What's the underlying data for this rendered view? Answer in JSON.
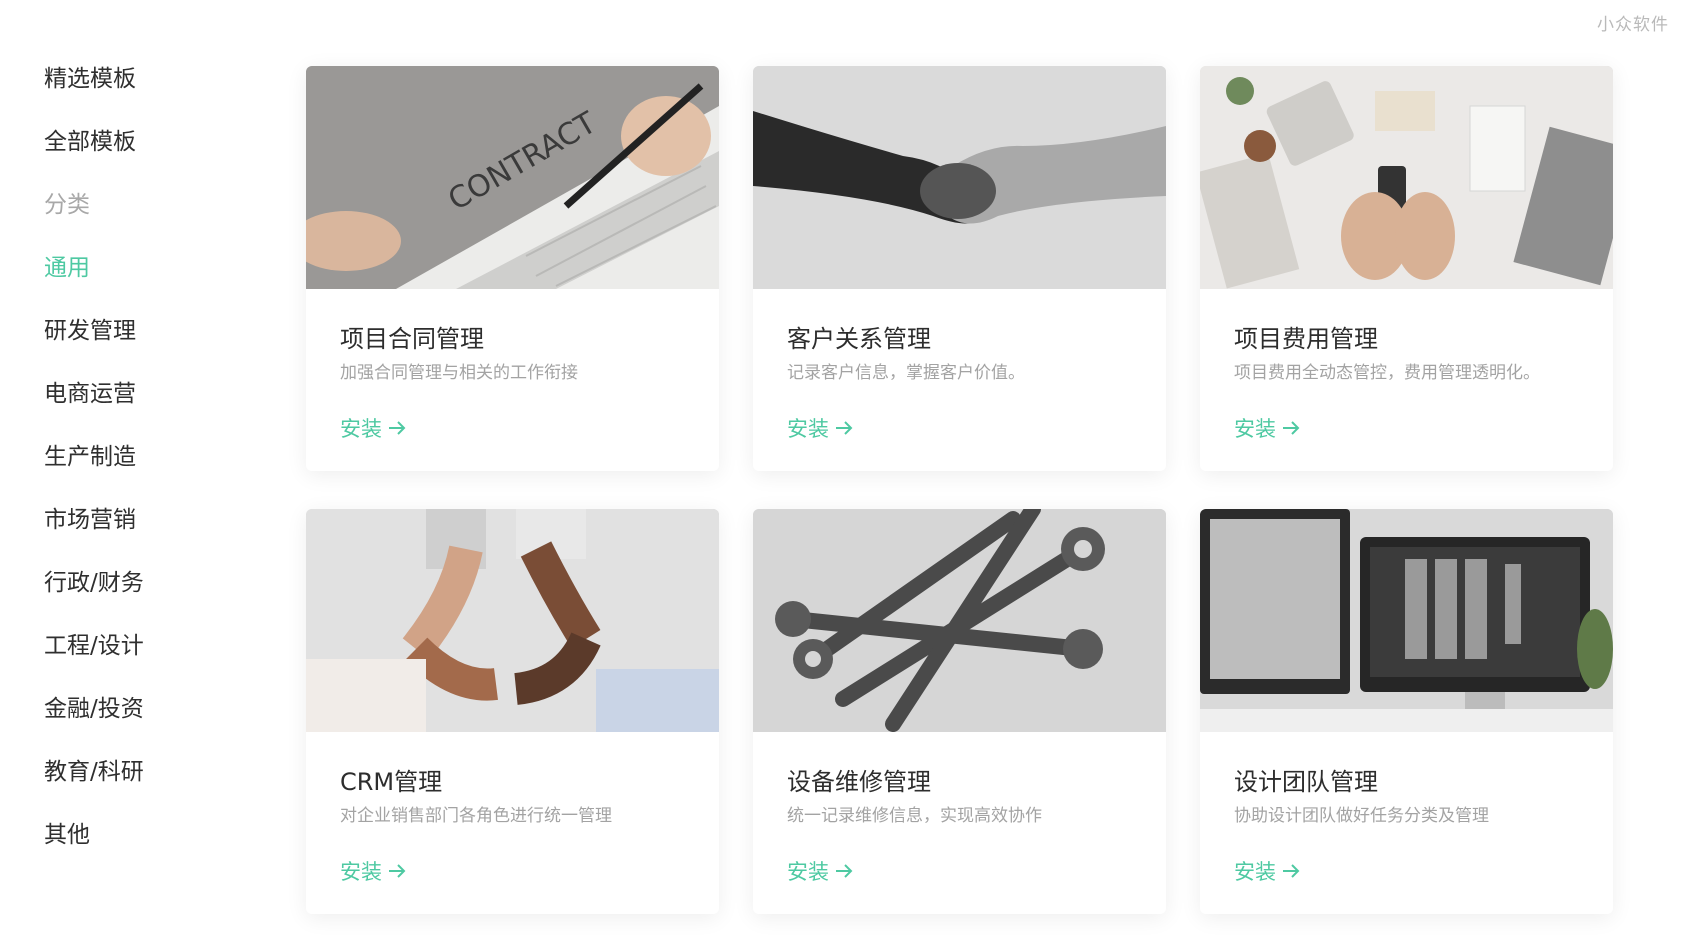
{
  "watermark": "小众软件",
  "sidebar": {
    "items": [
      {
        "label": "精选模板",
        "kind": "link"
      },
      {
        "label": "全部模板",
        "kind": "link"
      },
      {
        "label": "分类",
        "kind": "section"
      },
      {
        "label": "通用",
        "kind": "active"
      },
      {
        "label": "研发管理",
        "kind": "link"
      },
      {
        "label": "电商运营",
        "kind": "link"
      },
      {
        "label": "生产制造",
        "kind": "link"
      },
      {
        "label": "市场营销",
        "kind": "link"
      },
      {
        "label": "行政/财务",
        "kind": "link"
      },
      {
        "label": "工程/设计",
        "kind": "link"
      },
      {
        "label": "金融/投资",
        "kind": "link"
      },
      {
        "label": "教育/科研",
        "kind": "link"
      },
      {
        "label": "其他",
        "kind": "link"
      }
    ]
  },
  "accent_color": "#4ec9a2",
  "cards": [
    {
      "title": "项目合同管理",
      "desc": "加强合同管理与相关的工作衔接",
      "action": "安装",
      "image": "contract-photo",
      "image_text": "CONTRACT"
    },
    {
      "title": "客户关系管理",
      "desc": "记录客户信息，掌握客户价值。",
      "action": "安装",
      "image": "handshake-photo"
    },
    {
      "title": "项目费用管理",
      "desc": "项目费用全动态管控，费用管理透明化。",
      "action": "安装",
      "image": "desk-calculator-photo"
    },
    {
      "title": "CRM管理",
      "desc": "对企业销售部门各角色进行统一管理",
      "action": "安装",
      "image": "linked-hands-photo"
    },
    {
      "title": "设备维修管理",
      "desc": "统一记录维修信息，实现高效协作",
      "action": "安装",
      "image": "wrenches-photo"
    },
    {
      "title": "设计团队管理",
      "desc": "协助设计团队做好任务分类及管理",
      "action": "安装",
      "image": "design-monitors-photo"
    }
  ]
}
